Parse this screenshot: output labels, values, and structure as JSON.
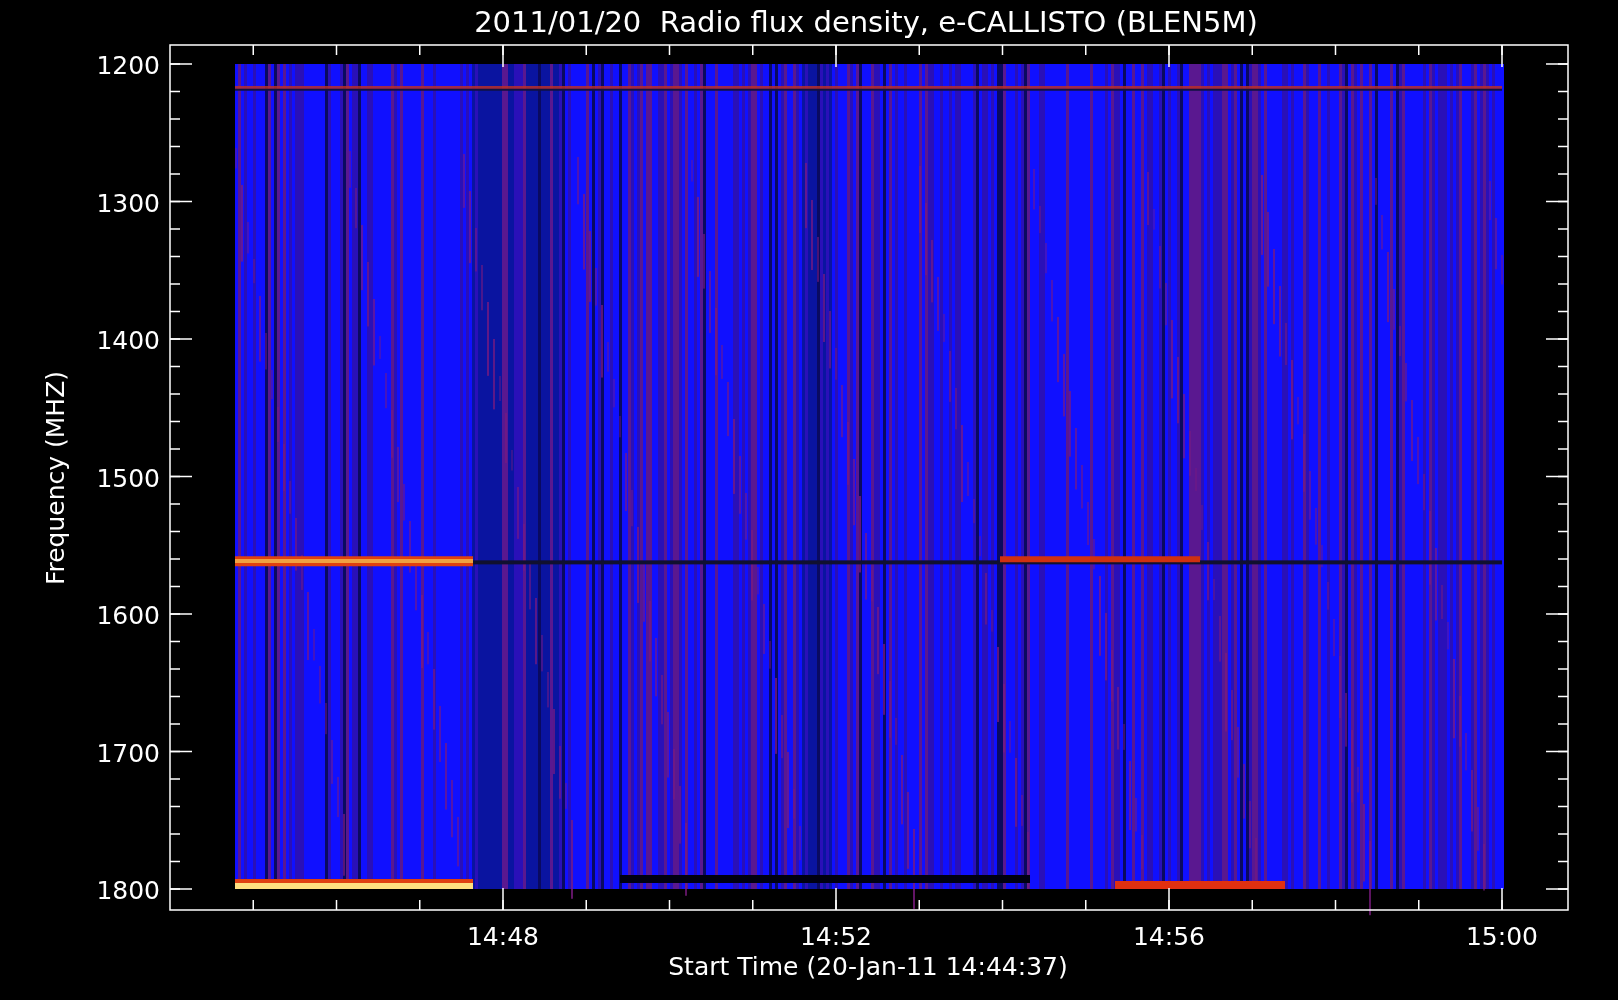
{
  "title": "2011/01/20  Radio flux density, e-CALLISTO (BLEN5M)",
  "ylabel": "Frequency (MHZ)",
  "xlabel": "Start Time (20-Jan-11 14:44:37)",
  "yticks": [
    "1200",
    "1300",
    "1400",
    "1500",
    "1600",
    "1700",
    "1800"
  ],
  "xticks": [
    "14:48",
    "14:52",
    "14:56",
    "15:00"
  ]
}
